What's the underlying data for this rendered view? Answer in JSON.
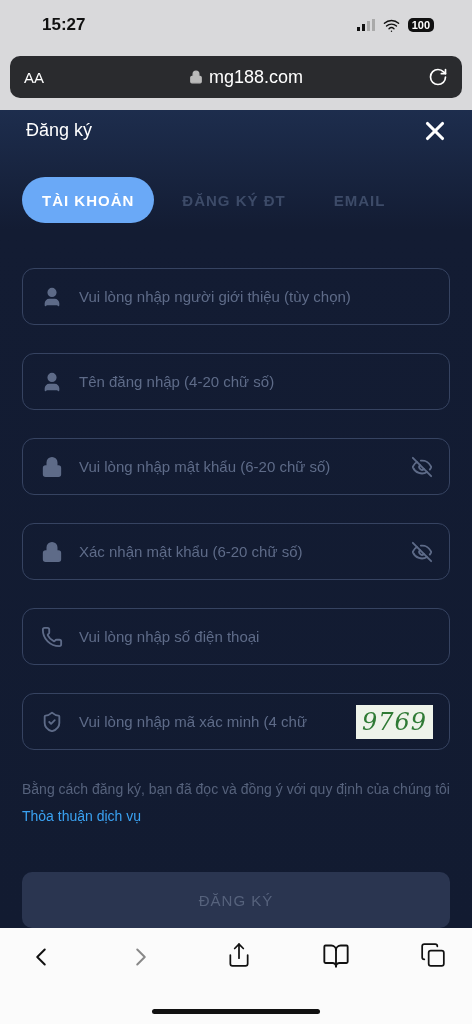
{
  "status_bar": {
    "time": "15:27",
    "battery": "100"
  },
  "browser": {
    "text_size": "AA",
    "url": "mg188.com"
  },
  "dialog": {
    "title": "Đăng ký",
    "tabs": [
      {
        "label": "TÀI KHOẢN",
        "selected": true
      },
      {
        "label": "ĐĂNG KÝ ĐT",
        "selected": false
      },
      {
        "label": "EMAIL",
        "selected": false
      }
    ],
    "fields": [
      {
        "kind": "user",
        "placeholder": "Vui lòng nhập người giới thiệu (tùy chọn)"
      },
      {
        "kind": "user",
        "placeholder": "Tên đăng nhập (4-20 chữ số)"
      },
      {
        "kind": "password",
        "placeholder": "Vui lòng nhập mật khẩu (6-20 chữ số)"
      },
      {
        "kind": "password",
        "placeholder": "Xác nhận mật khẩu (6-20 chữ số)"
      },
      {
        "kind": "phone",
        "placeholder": "Vui lòng nhập số điện thoại"
      },
      {
        "kind": "captcha",
        "placeholder": "Vui lòng nhập mã xác minh (4 chữ",
        "captcha": "9769"
      }
    ],
    "terms": {
      "text": "Bằng cách đăng ký, bạn đã đọc và đồng ý với quy định của chúng tôi",
      "link": "Thỏa thuận dịch vụ"
    },
    "submit": {
      "label": "ĐĂNG KÝ",
      "disabled": true
    }
  }
}
